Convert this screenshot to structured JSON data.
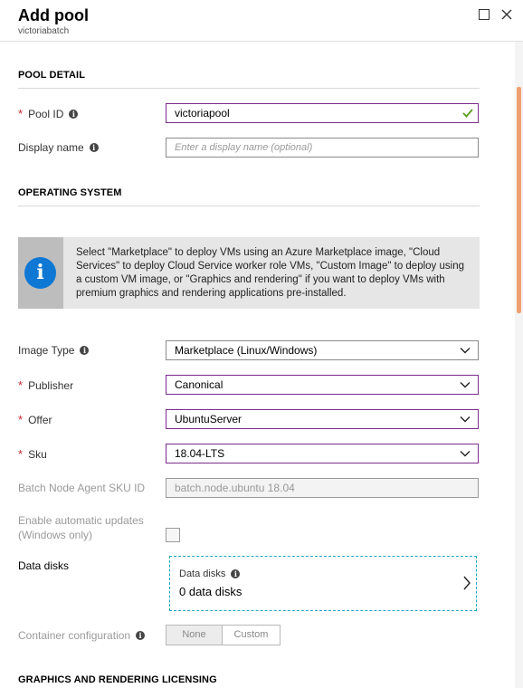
{
  "blade": {
    "title": "Add pool",
    "subtitle": "victoriabatch"
  },
  "sections": {
    "pool_detail": "POOL DETAIL",
    "operating_system": "OPERATING SYSTEM",
    "graphics": "GRAPHICS AND RENDERING LICENSING"
  },
  "pool_id": {
    "label": "Pool ID",
    "value": "victoriapool"
  },
  "display_name": {
    "label": "Display name",
    "placeholder": "Enter a display name (optional)"
  },
  "info_message": "Select \"Marketplace\" to deploy VMs using an Azure Marketplace image, \"Cloud Services\" to deploy Cloud Service worker role VMs, \"Custom Image\" to deploy using a custom VM image, or \"Graphics and rendering\" if you want to deploy VMs with premium graphics and rendering applications pre-installed.",
  "image_type": {
    "label": "Image Type",
    "value": "Marketplace (Linux/Windows)"
  },
  "publisher": {
    "label": "Publisher",
    "value": "Canonical"
  },
  "offer": {
    "label": "Offer",
    "value": "UbuntuServer"
  },
  "sku": {
    "label": "Sku",
    "value": "18.04-LTS"
  },
  "node_agent": {
    "label": "Batch Node Agent SKU ID",
    "value": "batch.node.ubuntu 18.04"
  },
  "auto_updates": {
    "label_line1": "Enable automatic updates",
    "label_line2": "(Windows only)",
    "checked": false
  },
  "data_disks": {
    "label": "Data disks",
    "card_title": "Data disks",
    "card_value": "0 data disks"
  },
  "container_config": {
    "label": "Container configuration",
    "options": [
      "None",
      "Custom"
    ],
    "selected": "None"
  },
  "colors": {
    "required": "#c4262e",
    "valid_border": "#7b2c8c",
    "info_blue": "#0f78d4",
    "valid_check": "#5b9b1a",
    "accent_dashed": "#1aa7c6"
  }
}
